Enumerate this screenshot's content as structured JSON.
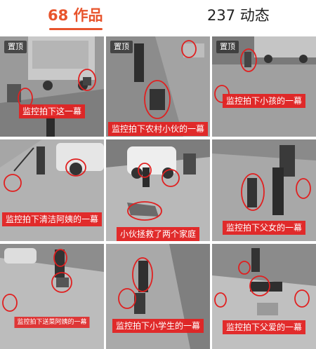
{
  "tabs": {
    "works": "68 作品",
    "dynamics": "237 动态"
  },
  "pinned_label": "置顶",
  "videos": [
    {
      "caption": "监控拍下这一幕",
      "pinned": true
    },
    {
      "caption": "监控拍下农村小伙的一幕",
      "pinned": true
    },
    {
      "caption": "监控拍下小孩的一幕",
      "pinned": true
    },
    {
      "caption": "监控拍下清洁阿姨的一幕"
    },
    {
      "caption": "小伙拯救了两个家庭"
    },
    {
      "caption": "监控拍下父女的一幕"
    },
    {
      "caption": "监控拍下送菜阿姨的一幕"
    },
    {
      "caption": "监控拍下小学生的一幕"
    },
    {
      "caption": "监控拍下父爱的一幕"
    }
  ],
  "colors": {
    "accent": "#e8542c",
    "caption_bg": "#e42020",
    "highlight_circle": "#e02020"
  }
}
